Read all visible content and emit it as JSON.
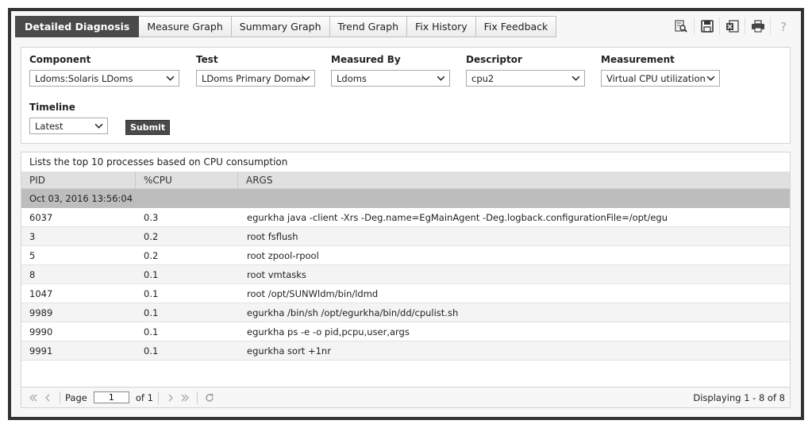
{
  "tabs": [
    {
      "label": "Detailed Diagnosis",
      "active": true
    },
    {
      "label": "Measure Graph"
    },
    {
      "label": "Summary Graph"
    },
    {
      "label": "Trend Graph"
    },
    {
      "label": "Fix History"
    },
    {
      "label": "Fix Feedback"
    }
  ],
  "toolbar_icons": [
    "zoom-search-icon",
    "save-icon",
    "excel-export-icon",
    "print-icon",
    "help-icon"
  ],
  "filters": {
    "component": {
      "label": "Component",
      "value": "Ldoms:Solaris LDoms"
    },
    "test": {
      "label": "Test",
      "value": "LDoms Primary Domai"
    },
    "measured_by": {
      "label": "Measured By",
      "value": "Ldoms"
    },
    "descriptor": {
      "label": "Descriptor",
      "value": "cpu2"
    },
    "measurement": {
      "label": "Measurement",
      "value": "Virtual CPU utilization"
    },
    "timeline": {
      "label": "Timeline",
      "value": "Latest"
    },
    "submit_label": "Submit"
  },
  "results": {
    "caption": "Lists the top 10 processes based on CPU consumption",
    "columns": [
      "PID",
      "%CPU",
      "ARGS"
    ],
    "group": "Oct 03, 2016 13:56:04",
    "rows": [
      {
        "pid": "6037",
        "cpu": "0.3",
        "args": "egurkha java -client -Xrs -Deg.name=EgMainAgent -Deg.logback.configurationFile=/opt/egu"
      },
      {
        "pid": "3",
        "cpu": "0.2",
        "args": "root fsflush"
      },
      {
        "pid": "5",
        "cpu": "0.2",
        "args": "root zpool-rpool"
      },
      {
        "pid": "8",
        "cpu": "0.1",
        "args": "root vmtasks"
      },
      {
        "pid": "1047",
        "cpu": "0.1",
        "args": "root /opt/SUNWldm/bin/ldmd"
      },
      {
        "pid": "9989",
        "cpu": "0.1",
        "args": "egurkha /bin/sh /opt/egurkha/bin/dd/cpulist.sh"
      },
      {
        "pid": "9990",
        "cpu": "0.1",
        "args": "egurkha ps -e -o pid,pcpu,user,args"
      },
      {
        "pid": "9991",
        "cpu": "0.1",
        "args": "egurkha sort +1nr"
      }
    ]
  },
  "pager": {
    "page_label": "Page",
    "page_value": "1",
    "of_label": "of 1",
    "displaying": "Displaying 1 - 8 of 8"
  }
}
